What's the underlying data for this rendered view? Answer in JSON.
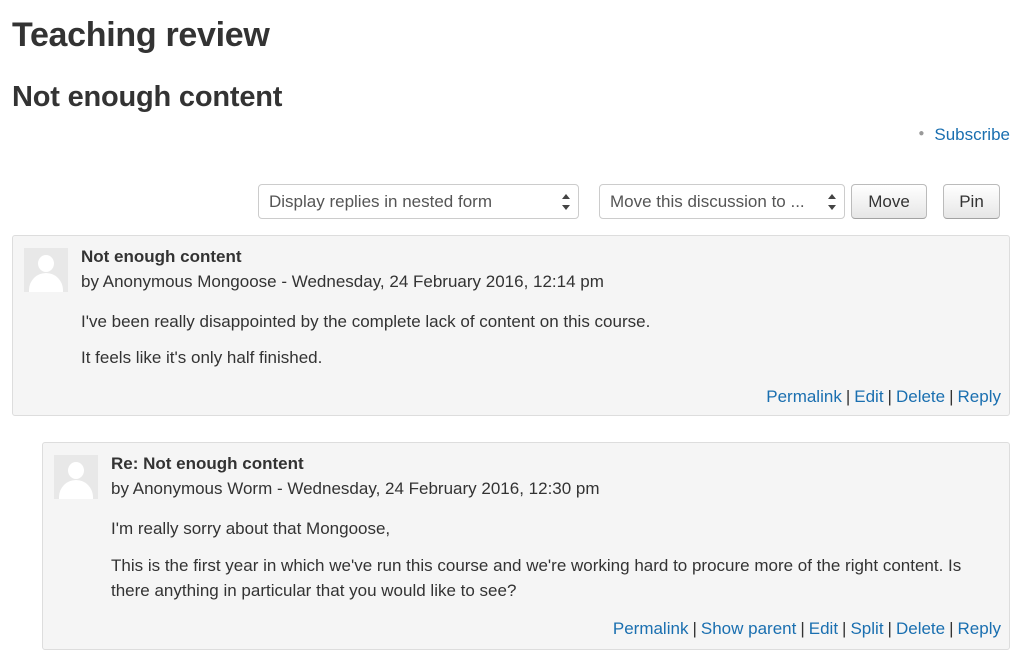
{
  "page": {
    "title": "Teaching review",
    "discussion_title": "Not enough content",
    "subscribe_label": "Subscribe"
  },
  "controls": {
    "display_mode": "Display replies in nested form",
    "move_select": "Move this discussion to ...",
    "move_button": "Move",
    "pin_button": "Pin"
  },
  "posts": [
    {
      "subject": "Not enough content",
      "byline": "by Anonymous Mongoose - Wednesday, 24 February 2016, 12:14 pm",
      "paragraphs": [
        "I've been really disappointed by the complete lack of content on this course.",
        "It feels like it's only half finished."
      ],
      "commands": [
        "Permalink",
        "Edit",
        "Delete",
        "Reply"
      ]
    },
    {
      "subject": "Re: Not enough content",
      "byline": "by Anonymous Worm - Wednesday, 24 February 2016, 12:30 pm",
      "paragraphs": [
        "I'm really sorry about that Mongoose,",
        "This is the first year in which we've run this course and we're working hard to procure more of the right content. Is there anything in particular that you would like to see?"
      ],
      "commands": [
        "Permalink",
        "Show parent",
        "Edit",
        "Split",
        "Delete",
        "Reply"
      ]
    }
  ]
}
